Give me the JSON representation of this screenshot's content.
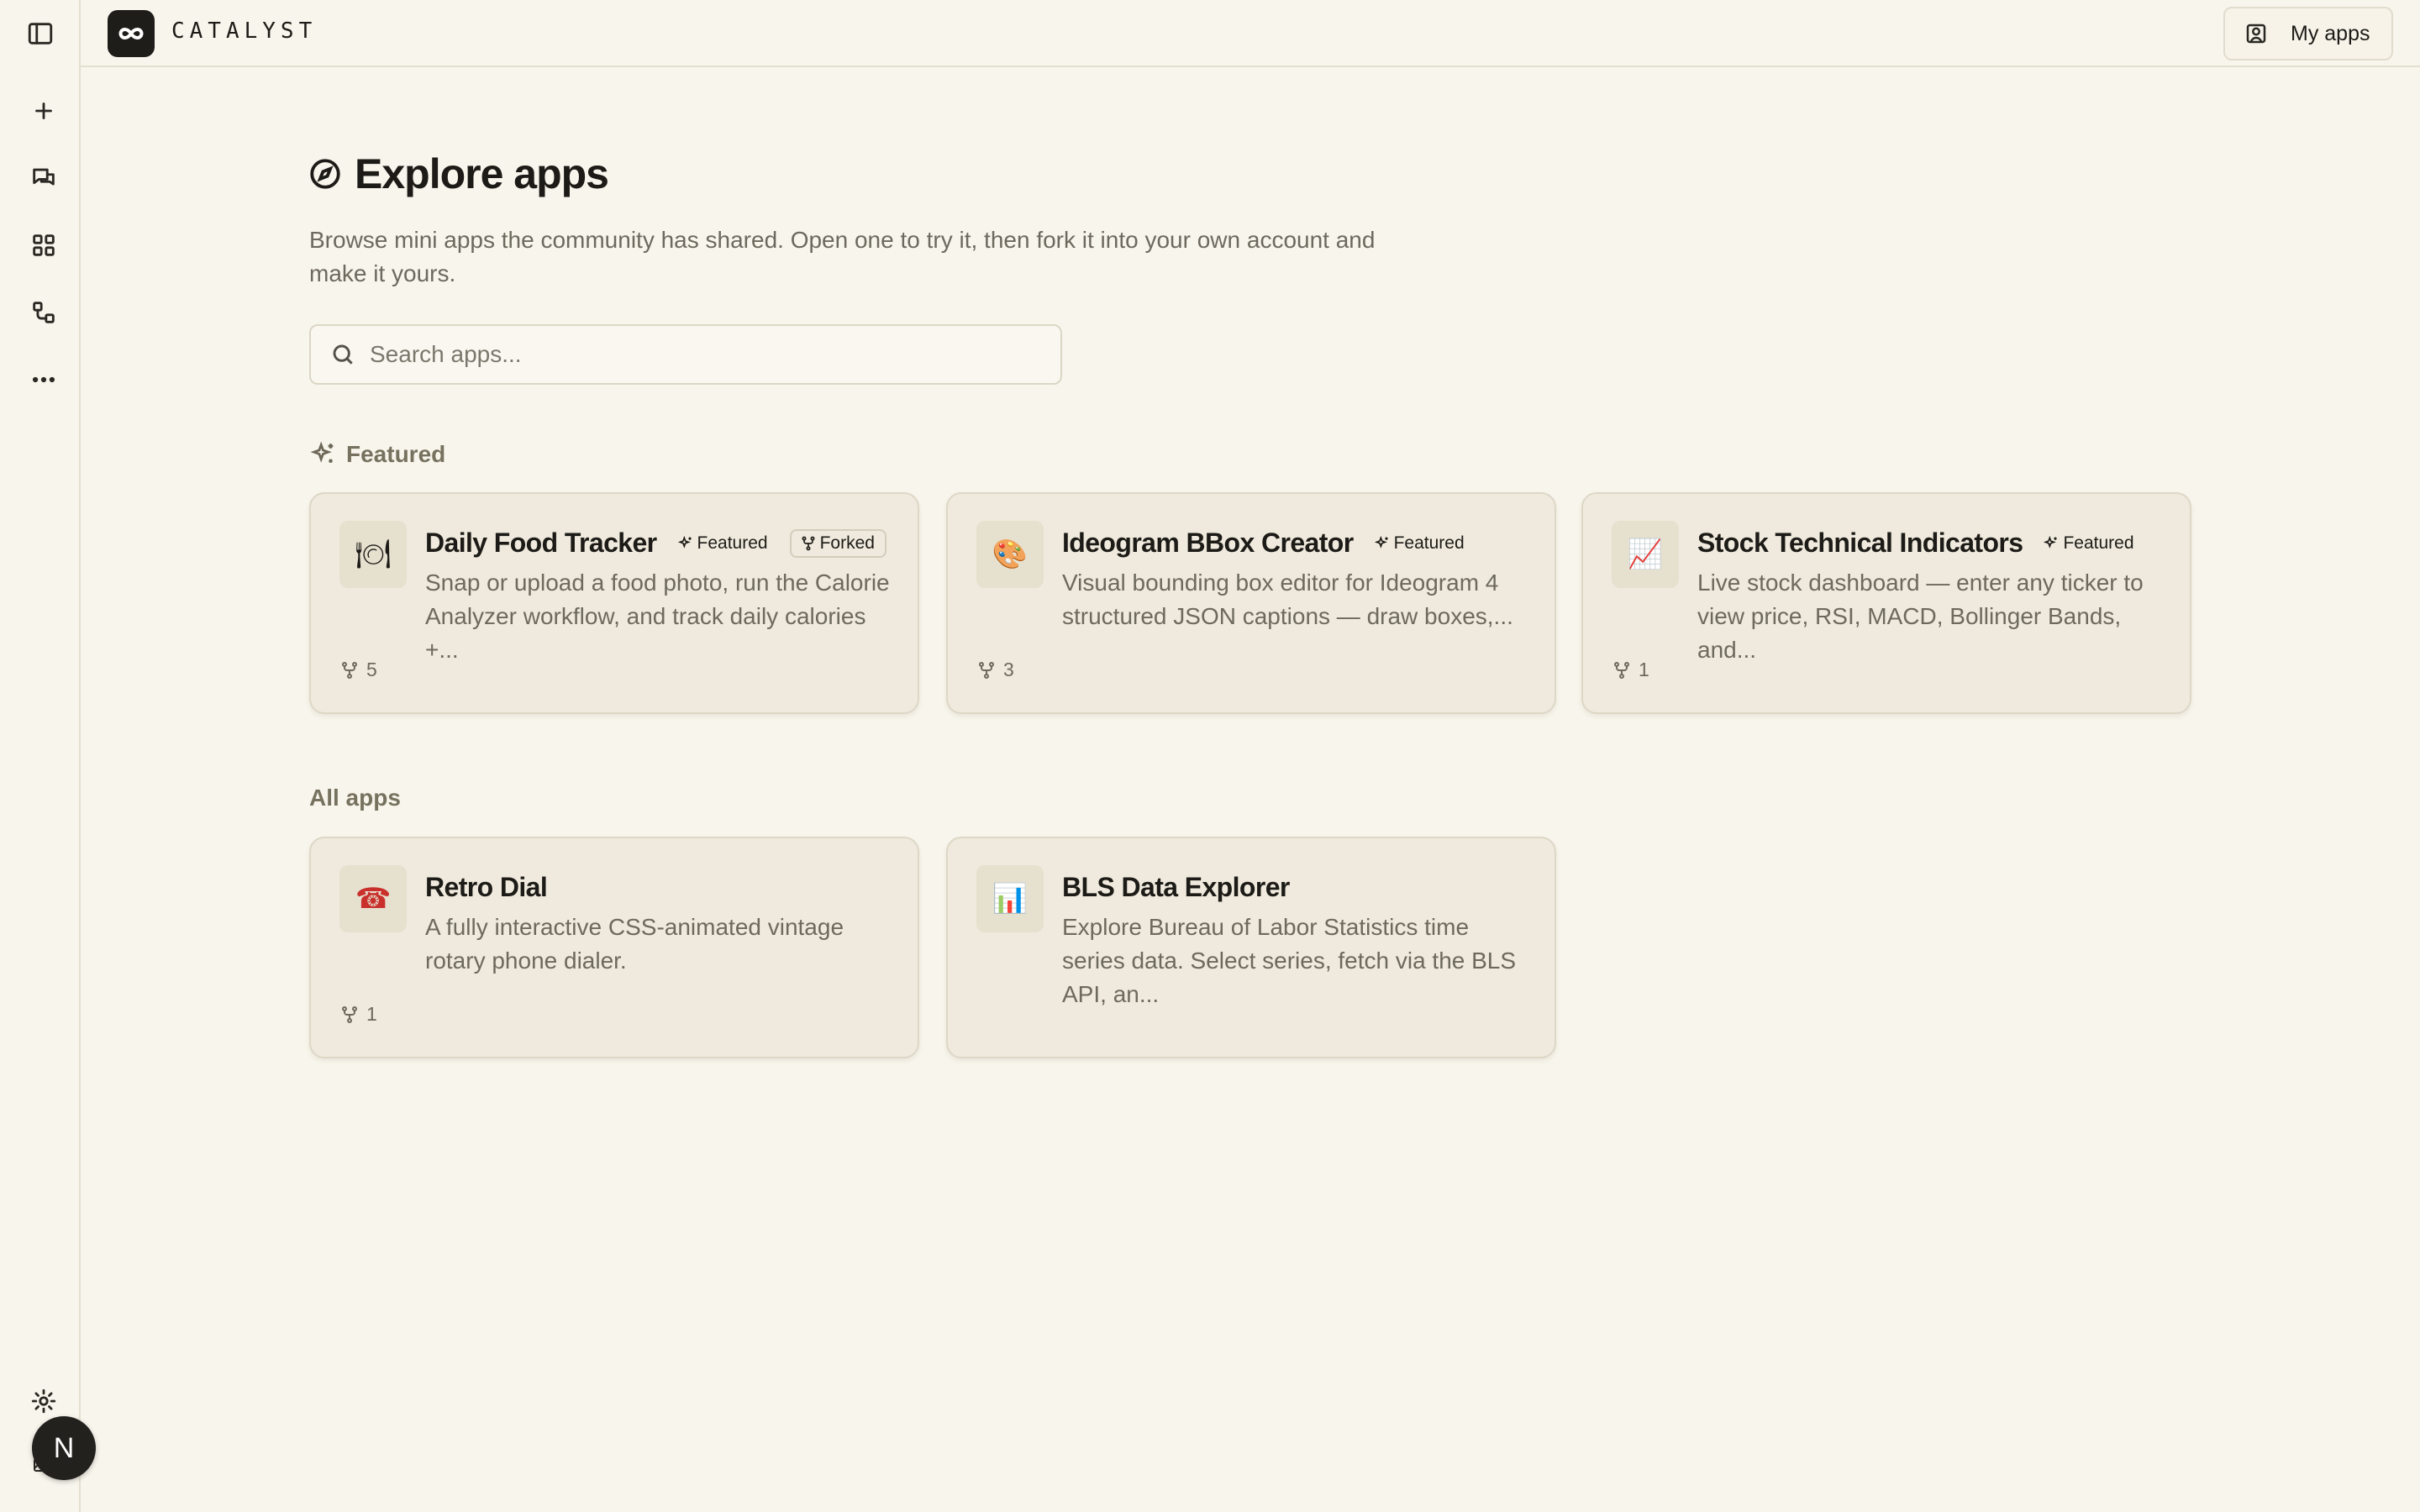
{
  "app": {
    "brand": "CATALYST"
  },
  "topbar": {
    "my_apps_label": "My apps"
  },
  "sidebar": {
    "items": [
      {
        "icon": "panel-left-icon"
      },
      {
        "icon": "plus-icon"
      },
      {
        "icon": "chat-icon"
      },
      {
        "icon": "grid-icon"
      },
      {
        "icon": "workflow-icon"
      },
      {
        "icon": "more-icon"
      },
      {
        "icon": "gear-icon"
      }
    ],
    "avatar_initial": "N"
  },
  "page": {
    "title": "Explore apps",
    "subtitle": "Browse mini apps the community has shared. Open one to try it, then fork it into your own account and make it yours."
  },
  "search": {
    "placeholder": "Search apps..."
  },
  "featured": {
    "label": "Featured",
    "apps": [
      {
        "icon_emoji": "🍽",
        "icon_name": "plate-icon",
        "title": "Daily Food Tracker",
        "badge_featured": "Featured",
        "badge_forked": "Forked",
        "description": "Snap or upload a food photo, run the Calorie Analyzer workflow, and track daily calories +...",
        "forks": "5"
      },
      {
        "icon_emoji": "🎨",
        "icon_name": "palette-icon",
        "title": "Ideogram BBox Creator",
        "badge_featured": "Featured",
        "description": "Visual bounding box editor for Ideogram 4 structured JSON captions — draw boxes,...",
        "forks": "3"
      },
      {
        "icon_emoji": "📈",
        "icon_name": "chart-up-icon",
        "title": "Stock Technical Indicators",
        "badge_featured": "Featured",
        "description": "Live stock dashboard — enter any ticker to view price, RSI, MACD, Bollinger Bands, and...",
        "forks": "1"
      }
    ]
  },
  "all_apps": {
    "label": "All apps",
    "apps": [
      {
        "icon_emoji": "☎",
        "icon_name": "telephone-icon",
        "title": "Retro Dial",
        "description": "A fully interactive CSS-animated vintage rotary phone dialer.",
        "forks": "1"
      },
      {
        "icon_emoji": "📊",
        "icon_name": "bar-chart-icon",
        "title": "BLS Data Explorer",
        "description": "Explore Bureau of Labor Statistics time series data. Select series, fetch via the BLS API, an..."
      }
    ]
  },
  "colors": {
    "background": "#f8f5ec",
    "card": "#efeadd",
    "text": "#1d1b17",
    "muted": "#6e695e",
    "avatar": "#23211d",
    "telephone": "#c9302c"
  }
}
